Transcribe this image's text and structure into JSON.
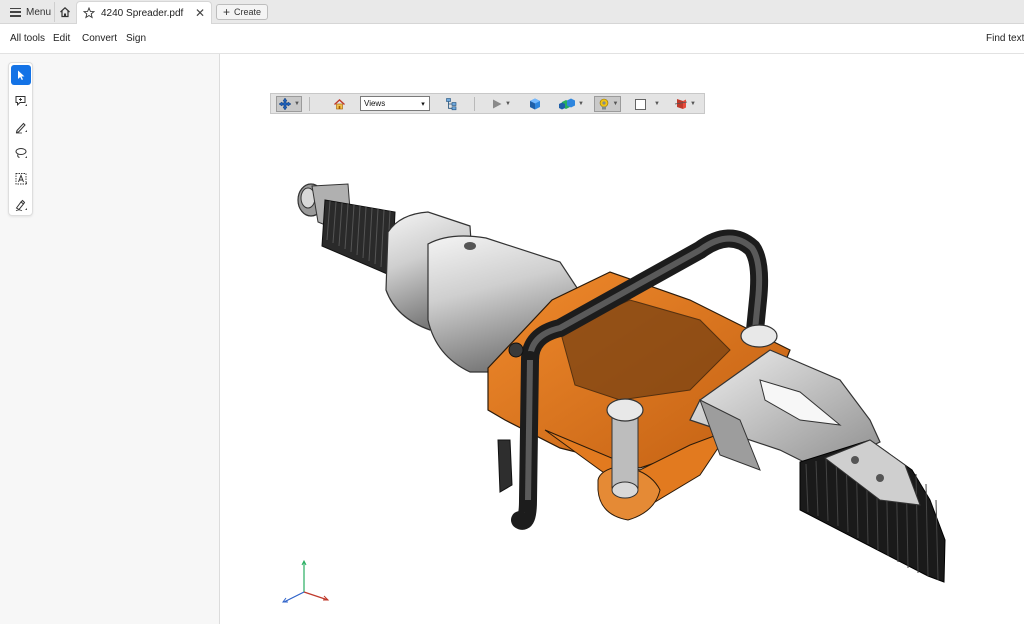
{
  "tabbar": {
    "menu_label": "Menu",
    "tab_title": "4240 Spreader.pdf",
    "close_glyph": "✕",
    "create_label": "Create"
  },
  "menubar": {
    "items": [
      "All tools",
      "Edit",
      "Convert",
      "Sign"
    ],
    "find_label": "Find text o"
  },
  "toolrail": {
    "tools": [
      "select-cursor-icon",
      "add-comment-icon",
      "draw-pen-icon",
      "lasso-icon",
      "text-select-icon",
      "signature-icon"
    ],
    "active_index": 0
  },
  "toolbar3d": {
    "views_label": "Views",
    "buttons": [
      "rotate-icon",
      "home-view-icon",
      "model-tree-icon",
      "play-animation-icon",
      "render-mode-icon",
      "lighting-icon",
      "camera-icon",
      "background-color-icon",
      "cross-section-icon"
    ]
  },
  "colors": {
    "accent": "#1473e6",
    "tabbar_bg": "#e9e9e9",
    "toolbar3d_bg": "#e4e4e4",
    "model_orange": "#e07b24",
    "model_dark": "#2e2e2e",
    "model_grey": "#b9b9b9"
  }
}
